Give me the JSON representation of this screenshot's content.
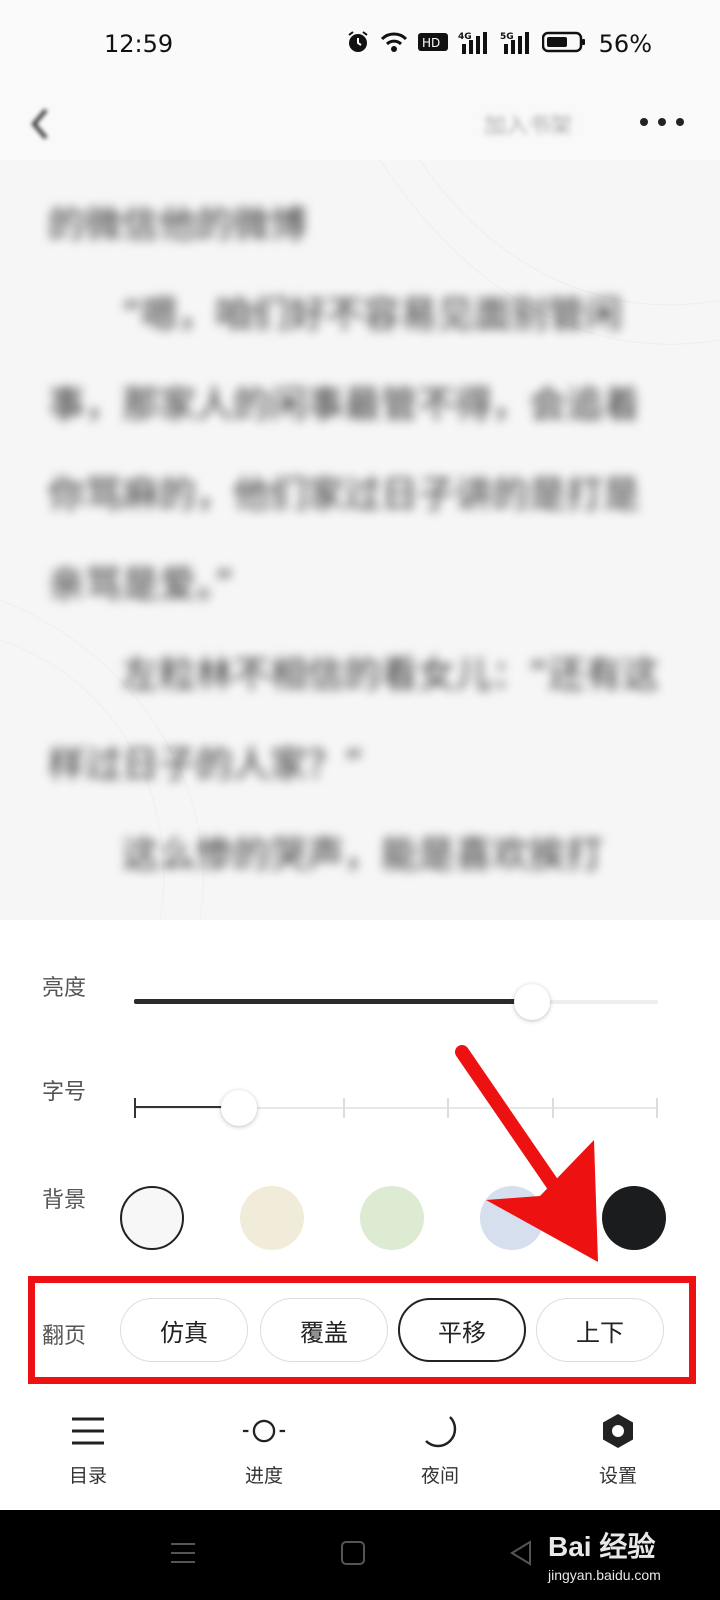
{
  "status_bar": {
    "time": "12:59",
    "battery_pct": "56%",
    "icons": [
      "alarm-icon",
      "wifi-icon",
      "hd-icon",
      "signal-4g-icon",
      "signal-5g-icon",
      "battery-icon"
    ]
  },
  "top_bar": {
    "bookshelf_label": "加入书架",
    "back_icon": "chevron-left-icon",
    "more_icon": "more-dots-icon"
  },
  "reader": {
    "paragraphs": [
      "的微信他的微博",
      "　　“嗯，咱们好不容易见面别管闲事，那家人的闲事最管不得，会追着你骂麻的，他们家过日子讲的是打是亲骂是爱。”",
      "　　左粒林不相信的看女儿：“还有这样过日子的人家？”",
      "　　这么惨的哭声，能是喜欢挨打"
    ]
  },
  "settings": {
    "brightness": {
      "label": "亮度",
      "level": 0.76
    },
    "font_size": {
      "label": "字号",
      "level": 0.2,
      "ticks": 6
    },
    "background": {
      "label": "背景",
      "swatches": [
        {
          "name": "white",
          "color": "#f7f7f7",
          "selected": true
        },
        {
          "name": "beige",
          "color": "#f1ecd9",
          "selected": false
        },
        {
          "name": "green",
          "color": "#dcebd1",
          "selected": false
        },
        {
          "name": "blue",
          "color": "#d6dfee",
          "selected": false
        },
        {
          "name": "black",
          "color": "#1b1c1e",
          "selected": false
        }
      ]
    },
    "page_turn": {
      "label": "翻页",
      "options": [
        {
          "label": "仿真",
          "selected": false
        },
        {
          "label": "覆盖",
          "selected": false
        },
        {
          "label": "平移",
          "selected": true
        },
        {
          "label": "上下",
          "selected": false
        }
      ]
    }
  },
  "bottom_nav": [
    {
      "label": "目录",
      "icon": "menu-lines-icon"
    },
    {
      "label": "进度",
      "icon": "progress-circle-icon"
    },
    {
      "label": "夜间",
      "icon": "moon-icon"
    },
    {
      "label": "设置",
      "icon": "hexagon-settings-icon"
    }
  ],
  "watermark": {
    "brand": "Bai 经验",
    "site": "jingyan.baidu.com"
  },
  "colors": {
    "highlight": "#ee1111",
    "accent": "#222222"
  }
}
